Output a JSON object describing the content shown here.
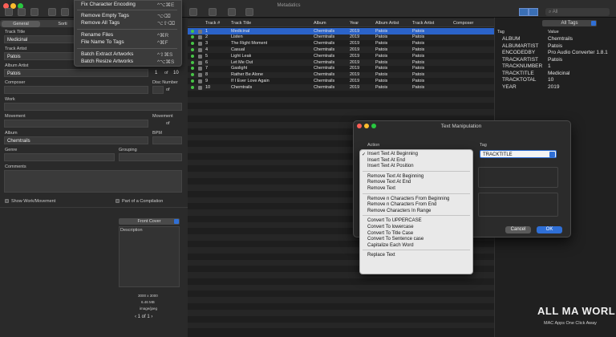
{
  "window": {
    "title": "Metadatics",
    "search_placeholder": "All"
  },
  "menu": {
    "items": [
      {
        "label": "Fix Character Encoding",
        "shortcut": "^⌥⌘E"
      },
      {
        "label": "Remove Empty Tags",
        "shortcut": "⌥⌫"
      },
      {
        "label": "Remove All Tags",
        "shortcut": "⌥⇧⌫"
      },
      {
        "label": "Rename Files",
        "shortcut": "^⌘R"
      },
      {
        "label": "File Name To Tags",
        "shortcut": "^⌘F"
      },
      {
        "label": "Batch Extract Artworks",
        "shortcut": "^⇧⌘S"
      },
      {
        "label": "Batch Resize Artworks",
        "shortcut": "^⌥⌘S"
      }
    ]
  },
  "left": {
    "tabs": [
      "General",
      "Sorti"
    ],
    "track_title_label": "Track Title",
    "track_title": "Medicinal",
    "track_artist_label": "Track Artist",
    "track_artist": "Patois",
    "album_artist_label": "Album Artist",
    "album_artist": "Patois",
    "number_label": "umber",
    "track_no": "1",
    "of_label": "of",
    "track_total": "10",
    "composer_label": "Composer",
    "disc_label": "Disc Number",
    "disc_of": "of",
    "work_label": "Work",
    "movement_label": "Movement",
    "movement2_label": "Movement",
    "movement_of": "of",
    "album_label": "Album",
    "album": "Chemtrails",
    "bpm_label": "BPM",
    "genre_label": "Genre",
    "grouping_label": "Grouping",
    "comments_label": "Comments",
    "show_work_label": "Show Work/Movement",
    "compilation_label": "Part of a Compilation",
    "artwork_type": "Front Cover",
    "description_label": "Description",
    "art_dims": "3000 x 3000",
    "art_size": "6.46 MB",
    "art_type": "image/jpeg",
    "art_page": "1 of 1"
  },
  "table": {
    "headers": [
      "Track #",
      "Track Title",
      "Album",
      "Year",
      "Album Artist",
      "Track Artist",
      "Composer"
    ],
    "rows": [
      {
        "n": "1",
        "title": "Medicinal",
        "album": "Chemtrails",
        "year": "2019",
        "aa": "Patois",
        "ta": "Patois"
      },
      {
        "n": "2",
        "title": "Listen",
        "album": "Chemtrails",
        "year": "2019",
        "aa": "Patois",
        "ta": "Patois"
      },
      {
        "n": "3",
        "title": "The Right Moment",
        "album": "Chemtrails",
        "year": "2019",
        "aa": "Patois",
        "ta": "Patois"
      },
      {
        "n": "4",
        "title": "Casual",
        "album": "Chemtrails",
        "year": "2019",
        "aa": "Patois",
        "ta": "Patois"
      },
      {
        "n": "5",
        "title": "Light Leak",
        "album": "Chemtrails",
        "year": "2019",
        "aa": "Patois",
        "ta": "Patois"
      },
      {
        "n": "6",
        "title": "Let Me Out",
        "album": "Chemtrails",
        "year": "2019",
        "aa": "Patois",
        "ta": "Patois"
      },
      {
        "n": "7",
        "title": "Gaslight",
        "album": "Chemtrails",
        "year": "2019",
        "aa": "Patois",
        "ta": "Patois"
      },
      {
        "n": "8",
        "title": "Rather Be Alone",
        "album": "Chemtrails",
        "year": "2019",
        "aa": "Patois",
        "ta": "Patois"
      },
      {
        "n": "9",
        "title": "If I Ever Love Again",
        "album": "Chemtrails",
        "year": "2019",
        "aa": "Patois",
        "ta": "Patois"
      },
      {
        "n": "10",
        "title": "Chemtrails",
        "album": "Chemtrails",
        "year": "2019",
        "aa": "Patois",
        "ta": "Patois"
      }
    ]
  },
  "tags": {
    "dropdown": "All Tags",
    "col_tag": "Tag",
    "col_value": "Value",
    "rows": [
      {
        "tag": "ALBUM",
        "value": "Chemtrails"
      },
      {
        "tag": "ALBUMARTIST",
        "value": "Patois"
      },
      {
        "tag": "ENCODEDBY",
        "value": "Pro Audio Converter 1.8.1"
      },
      {
        "tag": "TRACKARTIST",
        "value": "Patois"
      },
      {
        "tag": "TRACKNUMBER",
        "value": "1"
      },
      {
        "tag": "TRACKTITLE",
        "value": "Medicinal"
      },
      {
        "tag": "TRACKTOTAL",
        "value": "10"
      },
      {
        "tag": "YEAR",
        "value": "2019"
      }
    ]
  },
  "dialog": {
    "title": "Text Manipulation",
    "action_label": "Action",
    "tag_label": "Tag",
    "tag_value": "TRACKTITLE",
    "cancel": "Cancel",
    "ok": "OK",
    "check": "✓",
    "groups": [
      [
        "Insert Text At Beginning",
        "Insert Text At End",
        "Insert Text At Position"
      ],
      [
        "Remove Text At Beginning",
        "Remove Text At End",
        "Remove Text"
      ],
      [
        "Remove n Characters From Beginning",
        "Remove n Characters From End",
        "Remove Characters In Range"
      ],
      [
        "Convert To UPPERCASE",
        "Convert To lowercase",
        "Convert To Title Case",
        "Convert To Sentence case",
        "Capitalize Each Word"
      ],
      [
        "Replace Text"
      ]
    ]
  },
  "watermark": {
    "brand_a": "ALL MA",
    "brand_b": "WORLDS",
    "tagline": "MAC Apps One Click Away"
  },
  "colors": {
    "accent": "#2f6fd6",
    "selection": "#2b63c9",
    "status_green": "#47c447"
  }
}
